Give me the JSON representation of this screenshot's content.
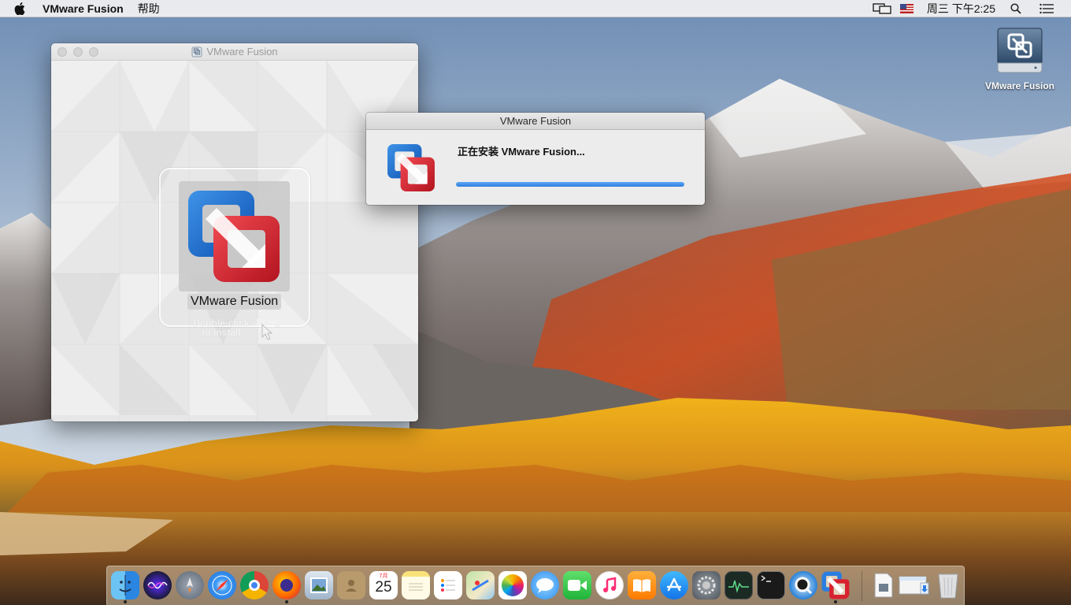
{
  "menubar": {
    "app_name": "VMware Fusion",
    "help_menu": "帮助",
    "clock": "周三 下午2:25"
  },
  "dmg_window": {
    "title": "VMware Fusion",
    "app_label": "VMware Fusion",
    "hint_line1": "Double-click",
    "hint_line2": "to Install"
  },
  "install_dialog": {
    "title": "VMware Fusion",
    "status": "正在安装 VMware Fusion...",
    "progress": 1.0
  },
  "desktop": {
    "drive_label": "VMware Fusion"
  },
  "dock": {
    "calendar_month": "7月",
    "calendar_day": "25",
    "items": [
      {
        "name": "finder-icon"
      },
      {
        "name": "siri-icon"
      },
      {
        "name": "launchpad-icon"
      },
      {
        "name": "safari-icon"
      },
      {
        "name": "chrome-icon"
      },
      {
        "name": "firefox-icon"
      },
      {
        "name": "preview-icon"
      },
      {
        "name": "contacts-icon"
      },
      {
        "name": "calendar-icon"
      },
      {
        "name": "notes-icon"
      },
      {
        "name": "reminders-icon"
      },
      {
        "name": "maps-icon"
      },
      {
        "name": "photos-icon"
      },
      {
        "name": "messages-icon"
      },
      {
        "name": "facetime-icon"
      },
      {
        "name": "itunes-icon"
      },
      {
        "name": "ibooks-icon"
      },
      {
        "name": "app-store-icon"
      },
      {
        "name": "system-preferences-icon"
      },
      {
        "name": "activity-monitor-icon"
      },
      {
        "name": "terminal-icon"
      },
      {
        "name": "quicktime-icon"
      },
      {
        "name": "vmware-fusion-icon"
      },
      {
        "name": "documents-stack-icon"
      },
      {
        "name": "downloads-stack-icon"
      },
      {
        "name": "trash-icon"
      }
    ]
  }
}
